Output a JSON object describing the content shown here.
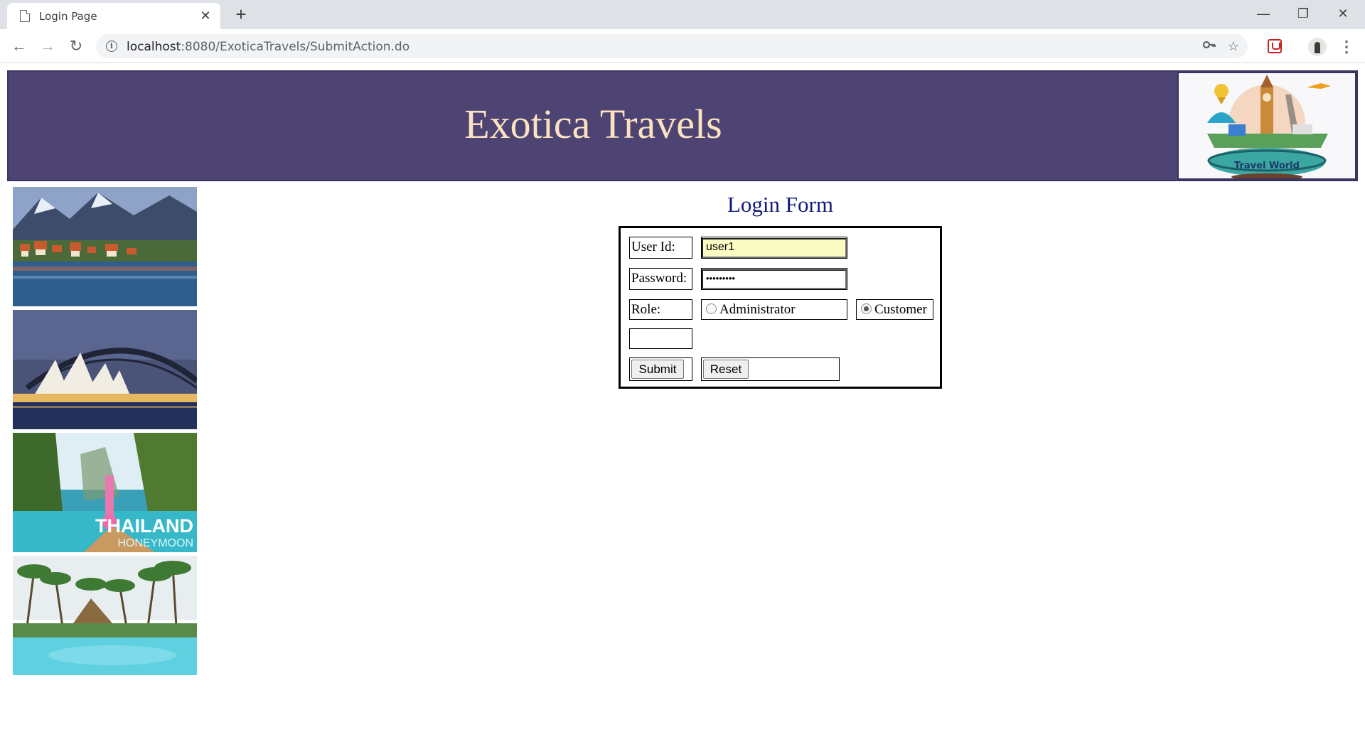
{
  "browser": {
    "tab_title": "Login Page",
    "tab_close": "✕",
    "new_tab": "+",
    "url_host": "localhost",
    "url_path": ":8080/ExoticaTravels/SubmitAction.do",
    "window_controls": {
      "minimize": "—",
      "maximize": "❐",
      "close": "✕"
    },
    "icons": [
      "back-icon",
      "forward-icon",
      "reload-icon",
      "info-icon",
      "key-icon",
      "star-icon",
      "extension-icon",
      "avatar",
      "menu-icon"
    ]
  },
  "banner": {
    "title": "Exotica Travels",
    "background_color": "#4e4473",
    "title_color": "#fbe3c1",
    "logo_text": "Travel World"
  },
  "thumbnails": [
    {
      "name": "swiss-lake-village"
    },
    {
      "name": "sydney-opera-harbour-bridge"
    },
    {
      "name": "thailand-honeymoon",
      "caption_main": "THAILAND",
      "caption_sub": "HONEYMOON"
    },
    {
      "name": "tropical-resort-pool"
    }
  ],
  "login_form": {
    "title": "Login Form",
    "title_color": "#0f1a7a",
    "user_id_label": "User Id:",
    "user_id_value": "user1",
    "password_label": "Password:",
    "password_mask": "•••••••••",
    "role_label": "Role:",
    "role_options": [
      {
        "label": "Administrator",
        "selected": false
      },
      {
        "label": "Customer",
        "selected": true
      }
    ],
    "submit_label": "Submit",
    "reset_label": "Reset"
  }
}
